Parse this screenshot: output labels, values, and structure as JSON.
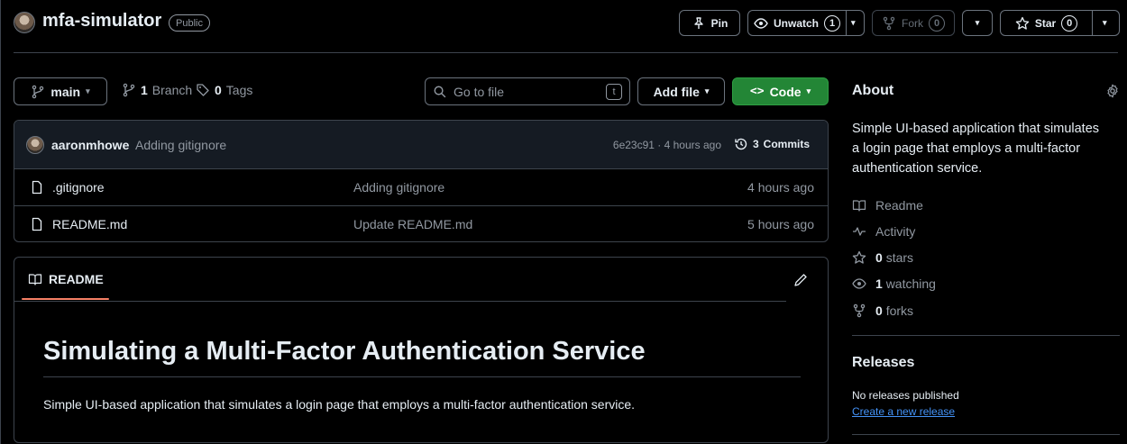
{
  "repo": {
    "name": "mfa-simulator",
    "visibility": "Public"
  },
  "header_actions": {
    "pin_label": "Pin",
    "unwatch_label": "Unwatch",
    "unwatch_count": "1",
    "fork_label": "Fork",
    "fork_count": "0",
    "star_label": "Star",
    "star_count": "0"
  },
  "toolbar": {
    "branch": "main",
    "branch_count": "1",
    "branch_word": "Branch",
    "tag_count": "0",
    "tag_word": "Tags",
    "search_placeholder": "Go to file",
    "search_shortcut": "t",
    "add_file_label": "Add file",
    "code_label": "Code"
  },
  "latest_commit": {
    "author": "aaronmhowe",
    "message": "Adding gitignore",
    "meta": "6e23c91 · 4 hours ago",
    "commits_count": "3",
    "commits_word": "Commits"
  },
  "files": [
    {
      "name": ".gitignore",
      "message": "Adding gitignore",
      "time": "4 hours ago"
    },
    {
      "name": "README.md",
      "message": "Update README.md",
      "time": "5 hours ago"
    }
  ],
  "readme": {
    "tab_label": "README",
    "heading": "Simulating a Multi-Factor Authentication Service",
    "body": "Simple UI-based application that simulates a login page that employs a multi-factor authentication service."
  },
  "about": {
    "title": "About",
    "description": "Simple UI-based application that simulates a login page that employs a multi-factor authentication service.",
    "readme_label": "Readme",
    "activity_label": "Activity",
    "stars_count": "0",
    "stars_word": "stars",
    "watching_count": "1",
    "watching_word": "watching",
    "forks_count": "0",
    "forks_word": "forks"
  },
  "releases": {
    "title": "Releases",
    "empty_text": "No releases published",
    "create_link": "Create a new release"
  },
  "colors": {
    "accent_green": "#238636",
    "link_blue": "#4493f8",
    "tab_underline": "#f78166",
    "border": "#3d444d"
  }
}
